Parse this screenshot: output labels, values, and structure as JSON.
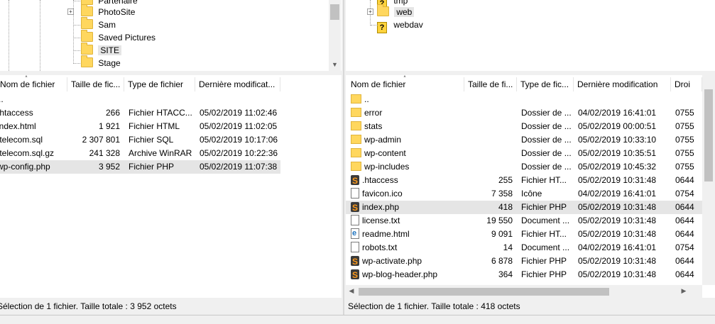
{
  "local_tree": {
    "items": [
      {
        "label": "Partenaire",
        "expander": false
      },
      {
        "label": "PhotoSite",
        "expander": true
      },
      {
        "label": "Sam",
        "expander": false
      },
      {
        "label": "Saved Pictures",
        "expander": false
      },
      {
        "label": "SITE",
        "expander": false,
        "selected": true
      },
      {
        "label": "Stage",
        "expander": false
      }
    ]
  },
  "remote_tree": {
    "items": [
      {
        "label": "tmp",
        "icon": "question-folder-icon"
      },
      {
        "label": "web",
        "icon": "folder-icon",
        "expander": true,
        "selected": true
      },
      {
        "label": "webdav",
        "icon": "question-folder-icon"
      }
    ]
  },
  "local_list": {
    "columns": [
      "Nom de fichier",
      "Taille de fic...",
      "Type de fichier",
      "Dernière modificat..."
    ],
    "rows": [
      {
        "name": "..",
        "size": "",
        "type": "",
        "date": ""
      },
      {
        "name": ".htaccess",
        "size": "266",
        "type": "Fichier HTACC...",
        "date": "05/02/2019 11:02:46"
      },
      {
        "name": "index.html",
        "size": "1 921",
        "type": "Fichier HTML",
        "date": "05/02/2019 11:02:05"
      },
      {
        "name": "ttelecom.sql",
        "size": "2 307 801",
        "type": "Fichier SQL",
        "date": "05/02/2019 10:17:06"
      },
      {
        "name": "ttelecom.sql.gz",
        "size": "241 328",
        "type": "Archive WinRAR",
        "date": "05/02/2019 10:22:36"
      },
      {
        "name": "wp-config.php",
        "size": "3 952",
        "type": "Fichier PHP",
        "date": "05/02/2019 11:07:38",
        "selected": true
      }
    ],
    "status": "Sélection de 1 fichier. Taille totale : 3 952 octets"
  },
  "remote_list": {
    "columns": [
      "Nom de fichier",
      "Taille de fi...",
      "Type de fic...",
      "Dernière modification",
      "Droi"
    ],
    "rows": [
      {
        "name": "..",
        "icon": "folder",
        "size": "",
        "type": "",
        "date": "",
        "perm": ""
      },
      {
        "name": "error",
        "icon": "folder",
        "size": "",
        "type": "Dossier de ...",
        "date": "04/02/2019 16:41:01",
        "perm": "0755"
      },
      {
        "name": "stats",
        "icon": "folder",
        "size": "",
        "type": "Dossier de ...",
        "date": "05/02/2019 00:00:51",
        "perm": "0755"
      },
      {
        "name": "wp-admin",
        "icon": "folder",
        "size": "",
        "type": "Dossier de ...",
        "date": "05/02/2019 10:33:10",
        "perm": "0755"
      },
      {
        "name": "wp-content",
        "icon": "folder",
        "size": "",
        "type": "Dossier de ...",
        "date": "05/02/2019 10:35:51",
        "perm": "0755"
      },
      {
        "name": "wp-includes",
        "icon": "folder",
        "size": "",
        "type": "Dossier de ...",
        "date": "05/02/2019 10:45:32",
        "perm": "0755"
      },
      {
        "name": ".htaccess",
        "icon": "sublime",
        "size": "255",
        "type": "Fichier HT...",
        "date": "05/02/2019 10:31:48",
        "perm": "0644"
      },
      {
        "name": "favicon.ico",
        "icon": "doc",
        "size": "7 358",
        "type": "Icône",
        "date": "04/02/2019 16:41:01",
        "perm": "0754"
      },
      {
        "name": "index.php",
        "icon": "sublime",
        "size": "418",
        "type": "Fichier PHP",
        "date": "05/02/2019 10:31:48",
        "perm": "0644",
        "selected": true
      },
      {
        "name": "license.txt",
        "icon": "doc",
        "size": "19 550",
        "type": "Document ...",
        "date": "05/02/2019 10:31:48",
        "perm": "0644"
      },
      {
        "name": "readme.html",
        "icon": "ie",
        "size": "9 091",
        "type": "Fichier HT...",
        "date": "05/02/2019 10:31:48",
        "perm": "0644"
      },
      {
        "name": "robots.txt",
        "icon": "doc",
        "size": "14",
        "type": "Document ...",
        "date": "04/02/2019 16:41:01",
        "perm": "0754"
      },
      {
        "name": "wp-activate.php",
        "icon": "sublime",
        "size": "6 878",
        "type": "Fichier PHP",
        "date": "05/02/2019 10:31:48",
        "perm": "0644"
      },
      {
        "name": "wp-blog-header.php",
        "icon": "sublime",
        "size": "364",
        "type": "Fichier PHP",
        "date": "05/02/2019 10:31:48",
        "perm": "0644"
      }
    ],
    "status": "Sélection de 1 fichier. Taille totale : 418 octets"
  }
}
